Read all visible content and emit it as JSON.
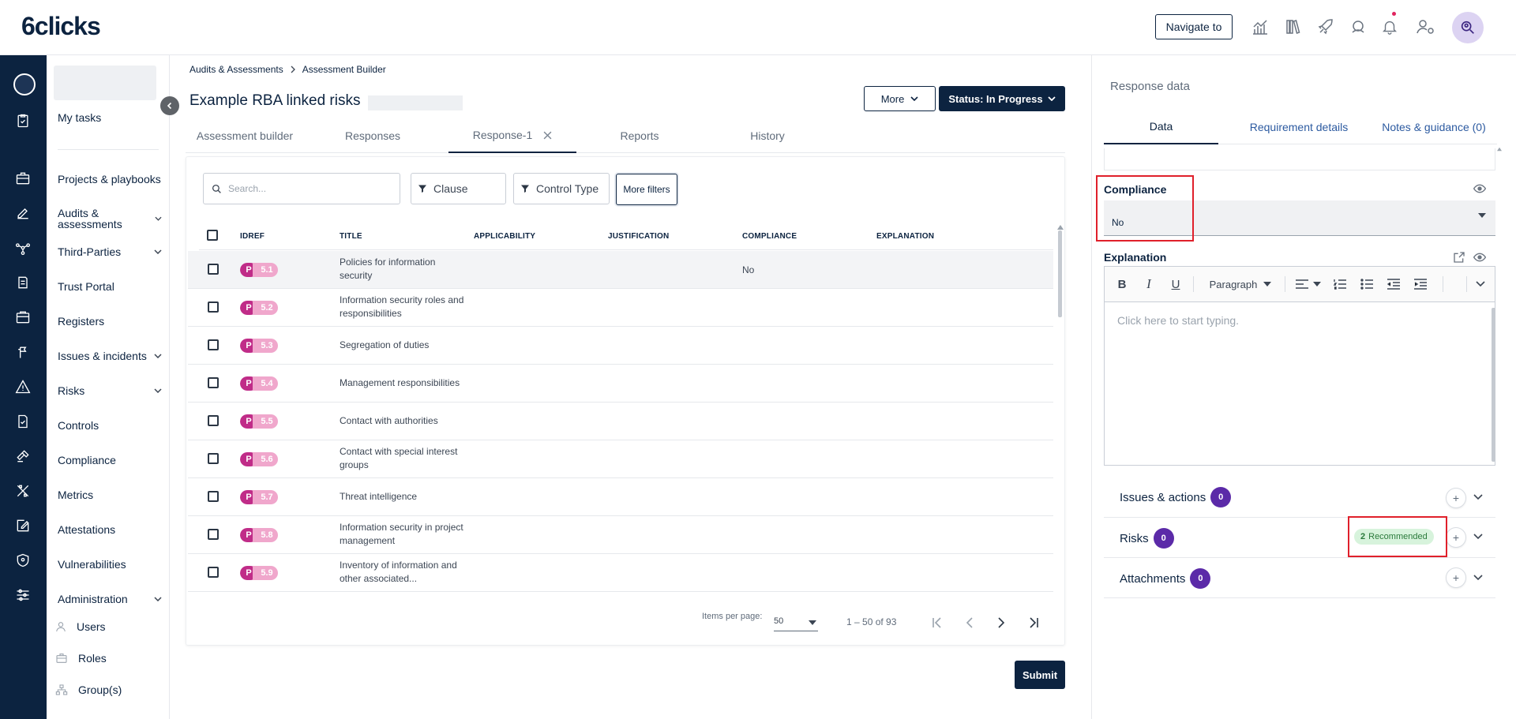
{
  "app": {
    "logo": "6clicks",
    "navigate_label": "Navigate to"
  },
  "sidebar": {
    "my_tasks": "My tasks",
    "items": [
      {
        "label": "Projects & playbooks",
        "chevron": false
      },
      {
        "label": "Audits & assessments",
        "chevron": true
      },
      {
        "label": "Third-Parties",
        "chevron": true
      },
      {
        "label": "Trust Portal",
        "chevron": false
      },
      {
        "label": "Registers",
        "chevron": false
      },
      {
        "label": "Issues & incidents",
        "chevron": true
      },
      {
        "label": "Risks",
        "chevron": true
      },
      {
        "label": "Controls",
        "chevron": false
      },
      {
        "label": "Compliance",
        "chevron": false
      },
      {
        "label": "Metrics",
        "chevron": false
      },
      {
        "label": "Attestations",
        "chevron": false
      },
      {
        "label": "Vulnerabilities",
        "chevron": false
      },
      {
        "label": "Administration",
        "chevron": true
      }
    ],
    "sub_items": [
      "Users",
      "Roles",
      "Group(s)"
    ]
  },
  "breadcrumb": [
    "Audits & Assessments",
    "Assessment Builder"
  ],
  "page": {
    "title": "Example RBA linked risks",
    "more_label": "More",
    "status_label": "Status: In Progress",
    "submit_label": "Submit"
  },
  "tabs": [
    "Assessment builder",
    "Responses",
    "Response-1",
    "Reports",
    "History"
  ],
  "active_tab": "Response-1",
  "filters": {
    "search_placeholder": "Search...",
    "clause": "Clause",
    "control_type": "Control Type",
    "more_filters": "More filters"
  },
  "table": {
    "headers": [
      "IDREF",
      "TITLE",
      "APPLICABILITY",
      "JUSTIFICATION",
      "COMPLIANCE",
      "EXPLANATION"
    ],
    "rows": [
      {
        "prefix": "P",
        "idref": "5.1",
        "title": "Policies for information security",
        "compliance": "No"
      },
      {
        "prefix": "P",
        "idref": "5.2",
        "title": "Information security roles and responsibilities",
        "compliance": ""
      },
      {
        "prefix": "P",
        "idref": "5.3",
        "title": "Segregation of duties",
        "compliance": ""
      },
      {
        "prefix": "P",
        "idref": "5.4",
        "title": "Management responsibilities",
        "compliance": ""
      },
      {
        "prefix": "P",
        "idref": "5.5",
        "title": "Contact with authorities",
        "compliance": ""
      },
      {
        "prefix": "P",
        "idref": "5.6",
        "title": "Contact with special interest groups",
        "compliance": ""
      },
      {
        "prefix": "P",
        "idref": "5.7",
        "title": "Threat intelligence",
        "compliance": ""
      },
      {
        "prefix": "P",
        "idref": "5.8",
        "title": "Information security in project management",
        "compliance": ""
      },
      {
        "prefix": "P",
        "idref": "5.9",
        "title": "Inventory of information and other associated...",
        "compliance": ""
      }
    ]
  },
  "pagination": {
    "items_per_page_label": "Items per page:",
    "items_per_page": "50",
    "range": "1 – 50 of 93"
  },
  "response_panel": {
    "title": "Response data",
    "tabs": [
      "Data",
      "Requirement details",
      "Notes & guidance (0)"
    ],
    "compliance_label": "Compliance",
    "compliance_value": "No",
    "explanation_label": "Explanation",
    "paragraph_label": "Paragraph",
    "editor_placeholder": "Click here to start typing.",
    "sections": [
      {
        "label": "Issues & actions",
        "count": "0"
      },
      {
        "label": "Risks",
        "count": "0",
        "recommended_count": "2",
        "recommended_label": "Recommended"
      },
      {
        "label": "Attachments",
        "count": "0"
      }
    ]
  },
  "colors": {
    "navy": "#0c2340",
    "pill": "#c02c88",
    "count_badge": "#5b2aa8",
    "highlight": "#e0202b",
    "recommended_bg": "#d7f3dc"
  }
}
